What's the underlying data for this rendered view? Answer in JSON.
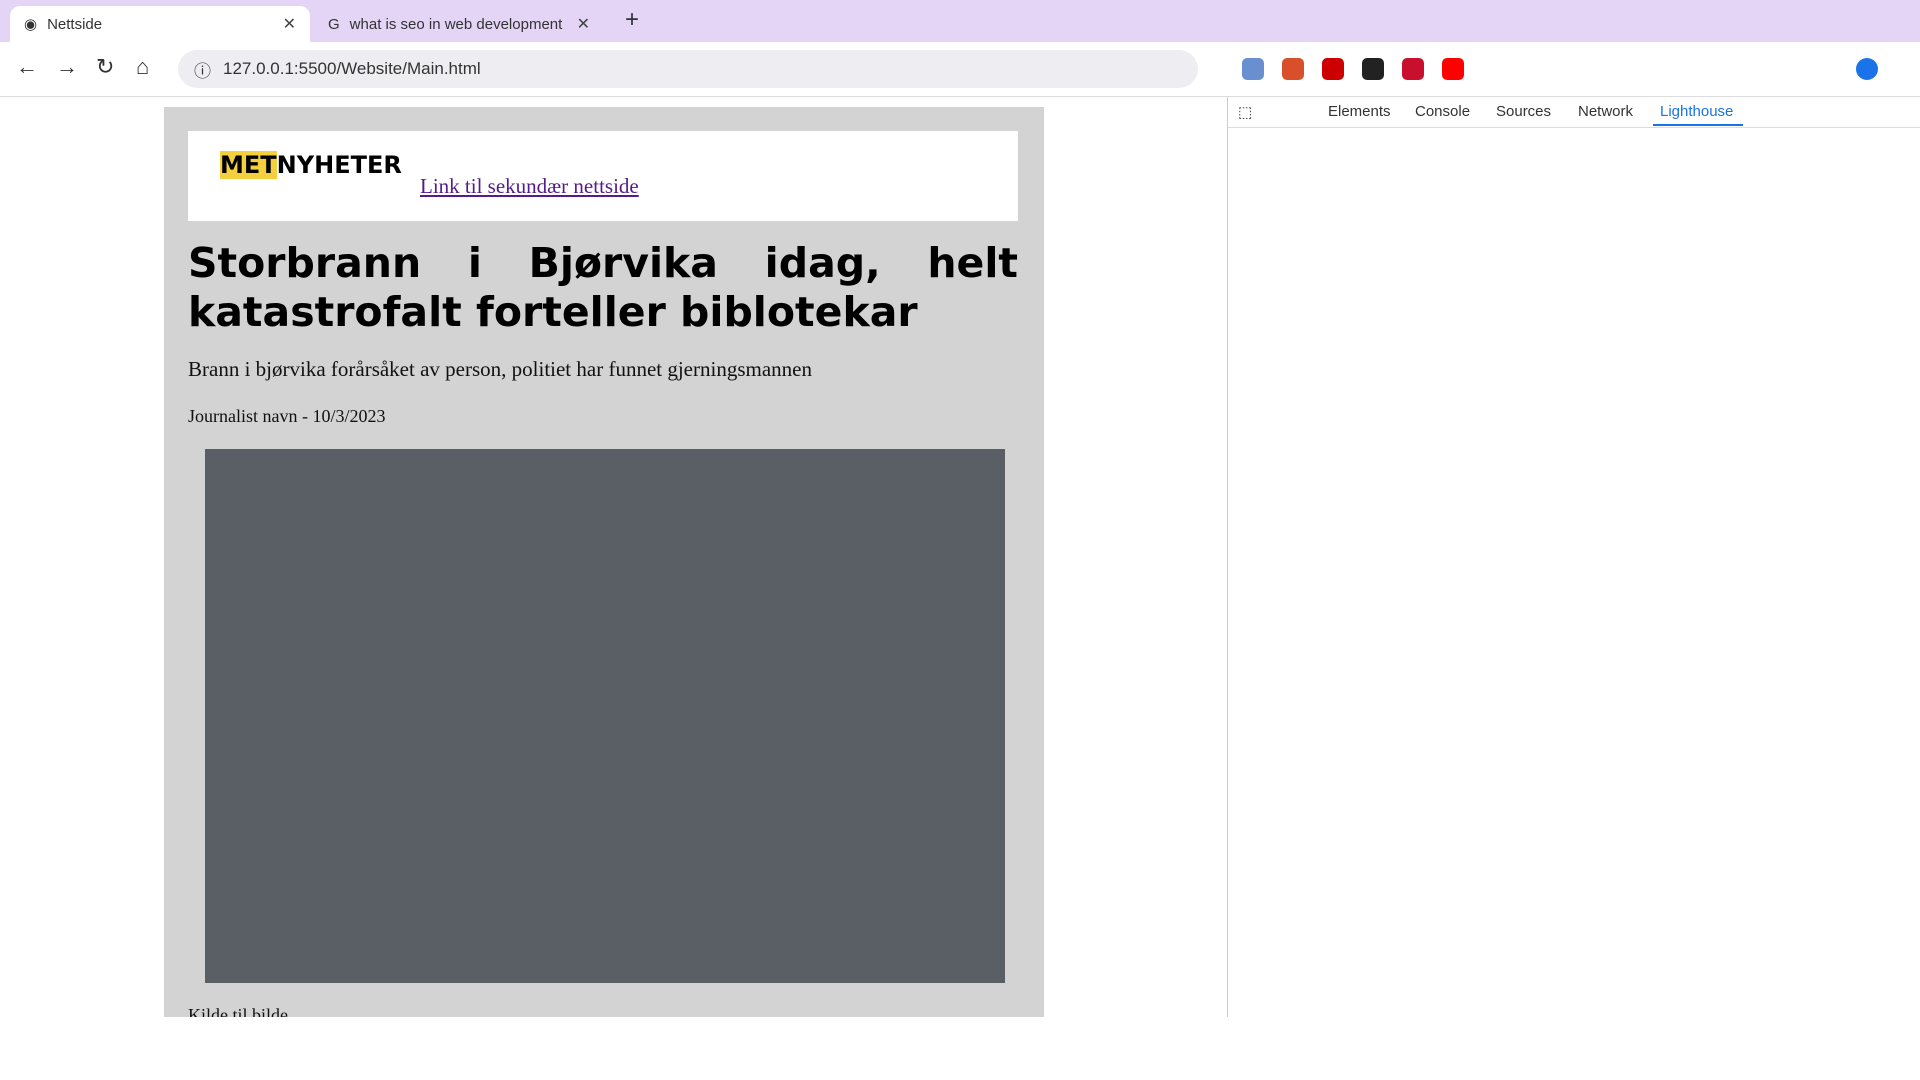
{
  "browser": {
    "tabs": [
      {
        "title": "Nettside",
        "active": true
      },
      {
        "title": "what is seo in web development",
        "active": false
      }
    ],
    "address": "127.0.0.1:5500/Website/Main.html"
  },
  "page": {
    "logo": {
      "highlight": "MET",
      "rest": "NYHETER"
    },
    "secondary_link": "Link til sekundær nettside",
    "headline": "Storbrann i Bjørvika idag, helt katastrofalt forteller biblotekar",
    "subtitle": "Brann i bjørvika forårsåket av person, politiet har funnet gjerningsmannen",
    "byline": "Journalist navn - 10/3/2023",
    "caption": "Kilde til bilde"
  },
  "devtools": {
    "tabs": [
      "Elements",
      "Console",
      "Sources",
      "Network",
      "Lighthouse"
    ],
    "active_tab": "Lighthouse"
  },
  "colors": {
    "tabstrip": "#e4d4f6",
    "accent": "#1a73e8",
    "logo_highlight": "#f4d03f"
  }
}
